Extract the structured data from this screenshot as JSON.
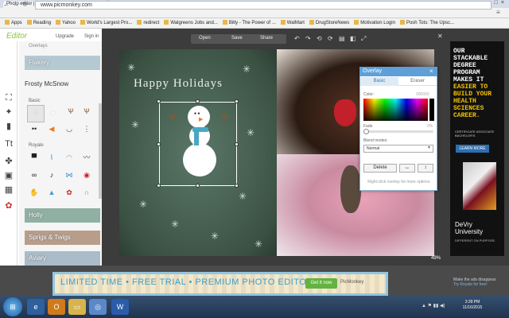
{
  "browser": {
    "tab_title": "Photo editor | PicMonkey",
    "url": "www.picmonkey.com",
    "bookmarks": [
      "Apps",
      "Reading",
      "Yahoo",
      "World's Largest Pro...",
      "redirect",
      "Walgreens Jobs and...",
      "Bitly - The Power of ...",
      "WalMart",
      "DrugStoreNews",
      "Motivation Login",
      "Posh Tots: The Upsc..."
    ]
  },
  "sidebar": {
    "logo": "Editor",
    "upgrade": "Upgrade",
    "sign_in": "Sign in",
    "section_title": "Overlays",
    "banners": {
      "flakery": "Flakery",
      "holly": "Holly",
      "sprigs": "Sprigs & Twigs",
      "aviary": "Aviary"
    },
    "group_name": "Frosty McSnow",
    "basic_label": "Basic",
    "royale_label": "Royale"
  },
  "toolbar": {
    "open": "Open",
    "save": "Save",
    "share": "Share"
  },
  "canvas": {
    "heading": "Happy Holidays",
    "zoom": "49%"
  },
  "overlay_panel": {
    "title": "Overlay",
    "tab_basic": "Basic",
    "tab_eraser": "Eraser",
    "color_label": "Color:",
    "color_value": "000000",
    "fade_label": "Fade",
    "fade_value": "0%",
    "fade_fraction": 0.0,
    "blend_label": "Blend modes:",
    "blend_value": "Normal",
    "delete": "Delete",
    "hint": "Right-click overlay for more options."
  },
  "side_ad": {
    "line1": "OUR",
    "line2": "STACKABLE",
    "line3": "DEGREE",
    "line4": "PROGRAM",
    "line5": "MAKES IT",
    "highlight1": "EASIER TO",
    "highlight2": "BUILD YOUR",
    "highlight3": "HEALTH",
    "highlight4": "SCIENCES",
    "highlight5": "CAREER.",
    "small": "CERTIFICATE ASSOCIATE BACHELOR'S",
    "button": "LEARN MORE",
    "brand1": "DeVry",
    "brand2": "University",
    "tagline": "DIFFERENT ON PURPOSE."
  },
  "bottom_ad": {
    "text": "LIMITED TIME • FREE TRIAL • PREMIUM PHOTO EDITOR",
    "button": "Get it now",
    "logo": "PicMonkey",
    "note1": "Make the ads disappear.",
    "note2": "Try Royale for free!"
  },
  "taskbar": {
    "time": "3:39 PM",
    "date": "11/16/2015"
  }
}
